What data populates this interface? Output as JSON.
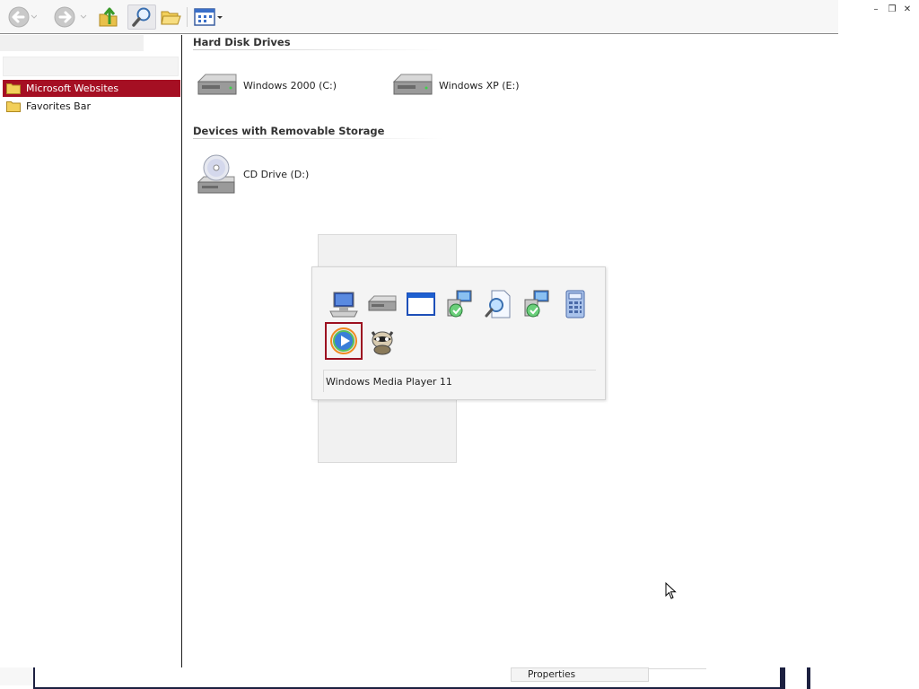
{
  "toolbar": {
    "buttons": [
      {
        "icon": "back-arrow-icon"
      },
      {
        "icon": "forward-arrow-icon"
      },
      {
        "icon": "up-folder-icon"
      },
      {
        "icon": "search-icon"
      },
      {
        "icon": "folders-icon"
      },
      {
        "icon": "views-icon"
      }
    ]
  },
  "caption_buttons": {
    "minimize": "–",
    "restore": "❐",
    "close": "✕"
  },
  "favorites": {
    "items": [
      {
        "label": "Microsoft Websites",
        "selected": true
      },
      {
        "label": "Favorites Bar",
        "selected": false
      }
    ]
  },
  "content": {
    "groups": [
      {
        "title": "Hard Disk Drives",
        "items": [
          {
            "label": "Windows 2000 (C:)",
            "icon": "hard-drive-icon"
          },
          {
            "label": "Windows XP (E:)",
            "icon": "hard-drive-icon"
          }
        ]
      },
      {
        "title": "Devices with Removable Storage",
        "items": [
          {
            "label": "CD Drive (D:)",
            "icon": "cd-drive-icon"
          }
        ]
      }
    ]
  },
  "app_switcher": {
    "selected_label": "Windows Media Player 11",
    "apps": [
      {
        "icon": "my-computer-icon"
      },
      {
        "icon": "drive-icon"
      },
      {
        "icon": "window-icon"
      },
      {
        "icon": "network-setup-icon"
      },
      {
        "icon": "search-document-icon"
      },
      {
        "icon": "network-setup-icon"
      },
      {
        "icon": "calculator-icon"
      },
      {
        "icon": "windows-media-player-icon",
        "selected": true
      },
      {
        "icon": "raccoon-icon"
      }
    ]
  },
  "bottom": {
    "properties_label": "Properties"
  },
  "colors": {
    "selection": "#a50f23",
    "taskbar": "#1c2040"
  }
}
